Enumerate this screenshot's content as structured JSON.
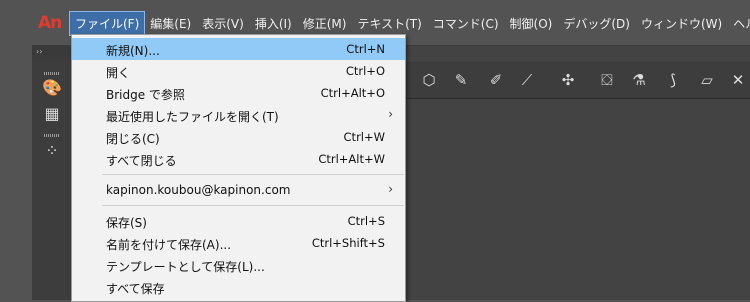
{
  "app": {
    "logo_text": "An",
    "logo_color": "#e23b2e"
  },
  "menubar": {
    "items": [
      {
        "label": "ファイル(F)",
        "active": true
      },
      {
        "label": "編集(E)"
      },
      {
        "label": "表示(V)"
      },
      {
        "label": "挿入(I)"
      },
      {
        "label": "修正(M)"
      },
      {
        "label": "テキスト(T)"
      },
      {
        "label": "コマンド(C)"
      },
      {
        "label": "制御(O)"
      },
      {
        "label": "デバッグ(D)"
      },
      {
        "label": "ウィンドウ(W)"
      },
      {
        "label": "ヘルプ"
      }
    ]
  },
  "tool_panel": {
    "collapse_label": "››",
    "tools": [
      {
        "name": "color-palette-icon",
        "glyph": "🎨"
      },
      {
        "name": "grid-icon",
        "glyph": "▦"
      },
      {
        "name": "dots-icon",
        "glyph": "⁘"
      }
    ]
  },
  "top_toolbar": {
    "icons": [
      {
        "name": "polystar-icon",
        "glyph": "⬡"
      },
      {
        "name": "pencil-icon",
        "glyph": "✎"
      },
      {
        "name": "paintbrush-icon",
        "glyph": "✐"
      },
      {
        "name": "brush-icon",
        "glyph": "⟋"
      },
      {
        "name": "bone-icon",
        "glyph": "✣"
      },
      {
        "name": "paint-bucket-icon",
        "glyph": "⛋"
      },
      {
        "name": "ink-bottle-icon",
        "glyph": "⚗"
      },
      {
        "name": "eyedropper-icon",
        "glyph": "⟆"
      },
      {
        "name": "eraser-icon",
        "glyph": "▱"
      },
      {
        "name": "width-icon",
        "glyph": "✕"
      }
    ]
  },
  "file_menu": {
    "items": [
      {
        "label": "新規(N)...",
        "shortcut": "Ctrl+N",
        "highlighted": true
      },
      {
        "label": "開く",
        "shortcut": "Ctrl+O"
      },
      {
        "label": "Bridge で参照",
        "shortcut": "Ctrl+Alt+O"
      },
      {
        "label": "最近使用したファイルを開く(T)",
        "submenu": true
      },
      {
        "label": "閉じる(C)",
        "shortcut": "Ctrl+W"
      },
      {
        "label": "すべて閉じる",
        "shortcut": "Ctrl+Alt+W"
      },
      {
        "separator": true
      },
      {
        "label": "kapinon.koubou@kapinon.com",
        "submenu": true
      },
      {
        "separator": true
      },
      {
        "label": "保存(S)",
        "shortcut": "Ctrl+S"
      },
      {
        "label": "名前を付けて保存(A)...",
        "shortcut": "Ctrl+Shift+S"
      },
      {
        "label": "テンプレートとして保存(L)..."
      },
      {
        "label": "すべて保存"
      }
    ],
    "submenu_arrow": "›"
  }
}
